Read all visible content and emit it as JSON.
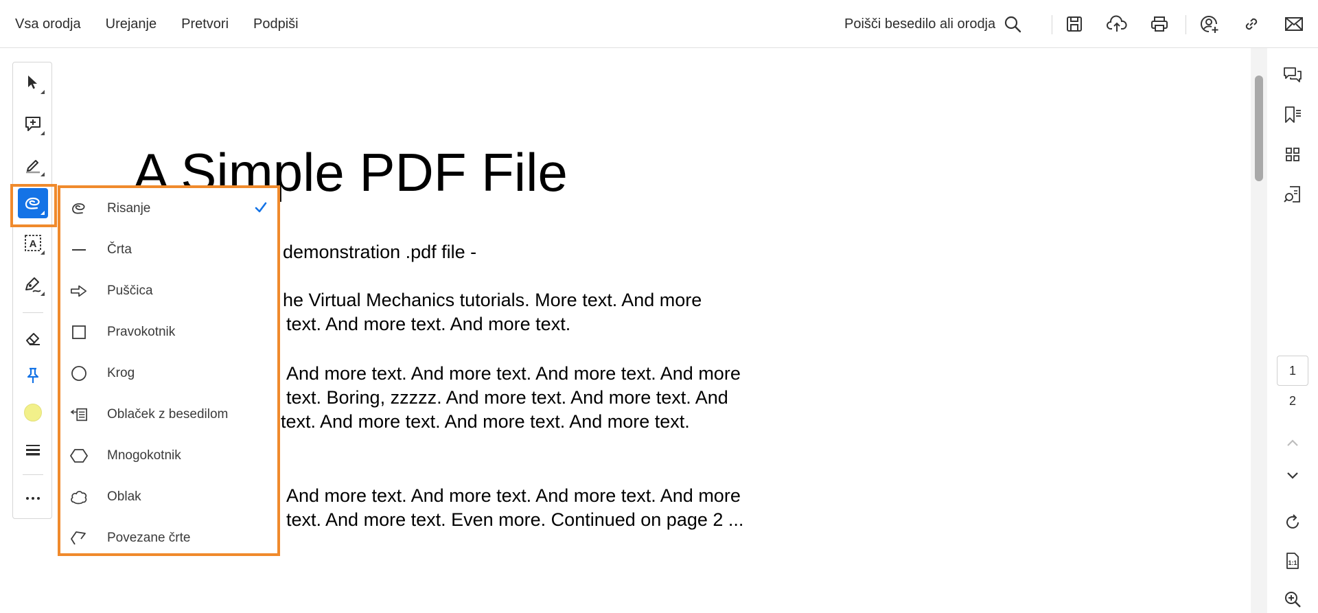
{
  "topbar": {
    "nav": [
      "Vsa orodja",
      "Urejanje",
      "Pretvori",
      "Podpiši"
    ],
    "search_label": "Poišči besedilo ali orodja"
  },
  "tool_rail": {
    "icons": [
      "select-arrow-icon",
      "add-comment-icon",
      "highlight-pen-icon",
      "freehand-draw-icon",
      "add-text-icon",
      "draw-tools-icon",
      "eraser-icon",
      "pin-icon",
      "color-swatch-icon",
      "line-weight-icon",
      "more-icon"
    ],
    "active": "freehand-draw-icon",
    "swatch_color": "#f2f08a"
  },
  "draw_menu": {
    "items": [
      {
        "label": "Risanje",
        "icon": "freehand-icon",
        "checked": true
      },
      {
        "label": "Črta",
        "icon": "line-icon",
        "checked": false
      },
      {
        "label": "Puščica",
        "icon": "arrow-icon",
        "checked": false
      },
      {
        "label": "Pravokotnik",
        "icon": "rectangle-icon",
        "checked": false
      },
      {
        "label": "Krog",
        "icon": "circle-icon",
        "checked": false
      },
      {
        "label": "Oblaček z besedilom",
        "icon": "text-callout-icon",
        "checked": false
      },
      {
        "label": "Mnogokotnik",
        "icon": "polygon-icon",
        "checked": false
      },
      {
        "label": "Oblak",
        "icon": "cloud-icon",
        "checked": false
      },
      {
        "label": "Povezane črte",
        "icon": "polyline-icon",
        "checked": false
      }
    ]
  },
  "document": {
    "title": "A Simple PDF File",
    "lines": [
      "demonstration .pdf file -",
      "he Virtual Mechanics tutorials. More text. And more",
      "text. And more text. And more text.",
      "And more text. And more text. And more text. And more",
      "text. Boring, zzzzz. And more text. And more text. And",
      "text. And more text. And more text.  And more text.",
      "And more text. And more text. And more text. And more",
      "text. And more text. Even more. Continued on page 2 ..."
    ]
  },
  "pages": {
    "current": "1",
    "next": "2"
  },
  "colors": {
    "accent": "#1473e6",
    "highlight_border": "#f08a2c"
  }
}
